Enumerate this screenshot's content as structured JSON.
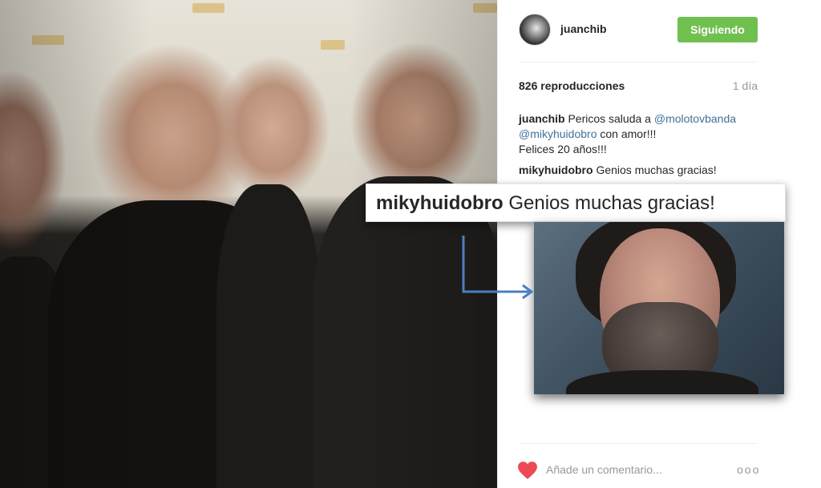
{
  "post": {
    "username": "juanchib",
    "follow_label": "Siguiendo",
    "views": "826 reproducciones",
    "time_ago": "1 día",
    "caption": {
      "user": "juanchib",
      "text_before": "Pericos saluda a ",
      "mention1": "@molotovbanda",
      "mention2": "@mikyhuidobro",
      "text_after": " con amor!!!",
      "line2": "Felices 20 años!!!"
    },
    "comments": [
      {
        "user": "mikyhuidobro",
        "text": "Genios muchas gracias!"
      }
    ],
    "comment_placeholder": "Añade un comentario...",
    "more_label": "ooo"
  },
  "callout": {
    "user": "mikyhuidobro",
    "text": "Genios muchas gracias!"
  },
  "colors": {
    "follow_button": "#70c050",
    "mention": "#3f729b",
    "like_heart": "#ed4956",
    "arrow": "#4a7fc1"
  },
  "icons": {
    "like": "heart-icon",
    "more": "more-options-icon"
  }
}
